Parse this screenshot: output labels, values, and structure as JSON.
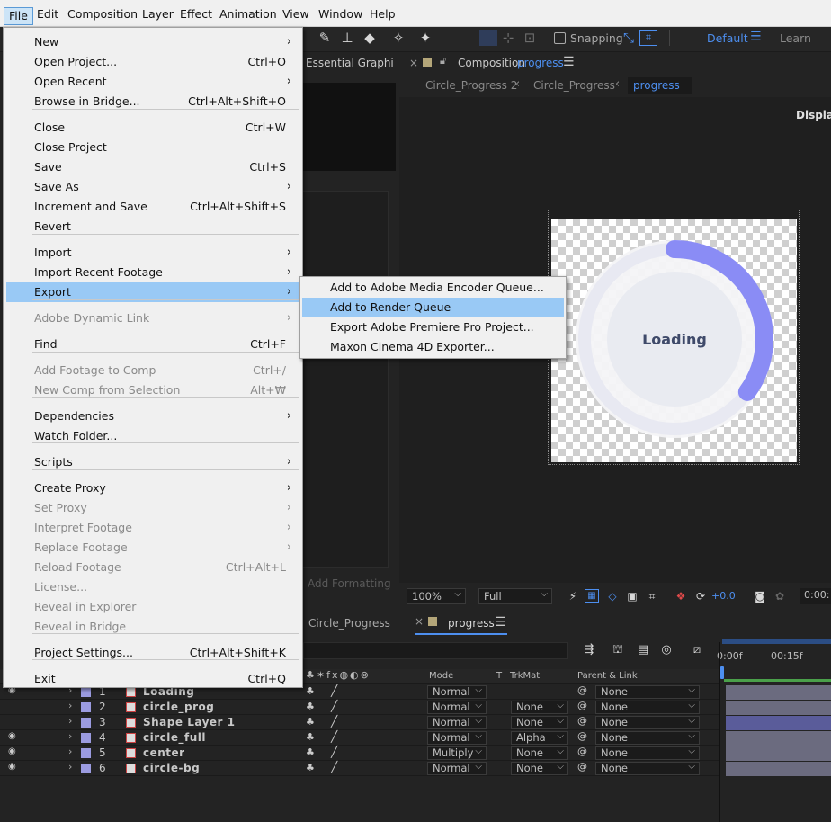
{
  "menubar": {
    "items": [
      "File",
      "Edit",
      "Composition",
      "Layer",
      "Effect",
      "Animation",
      "View",
      "Window",
      "Help"
    ]
  },
  "toolbar": {
    "snapping_label": "Snapping",
    "workspace_default": "Default",
    "workspace_learn": "Learn"
  },
  "file_menu": {
    "items": [
      {
        "label": "New",
        "shortcut": "",
        "arrow": "›"
      },
      {
        "label": "Open Project...",
        "shortcut": "Ctrl+O",
        "arrow": ""
      },
      {
        "label": "Open Recent",
        "shortcut": "",
        "arrow": "›"
      },
      {
        "label": "Browse in Bridge...",
        "shortcut": "Ctrl+Alt+Shift+O",
        "arrow": ""
      },
      {
        "label": "Close",
        "shortcut": "Ctrl+W",
        "arrow": ""
      },
      {
        "label": "Close Project",
        "shortcut": "",
        "arrow": ""
      },
      {
        "label": "Save",
        "shortcut": "Ctrl+S",
        "arrow": ""
      },
      {
        "label": "Save As",
        "shortcut": "",
        "arrow": "›"
      },
      {
        "label": "Increment and Save",
        "shortcut": "Ctrl+Alt+Shift+S",
        "arrow": ""
      },
      {
        "label": "Revert",
        "shortcut": "",
        "arrow": ""
      },
      {
        "label": "Import",
        "shortcut": "",
        "arrow": "›"
      },
      {
        "label": "Import Recent Footage",
        "shortcut": "",
        "arrow": "›"
      },
      {
        "label": "Export",
        "shortcut": "",
        "arrow": "›"
      },
      {
        "label": "Adobe Dynamic Link",
        "shortcut": "",
        "arrow": "›"
      },
      {
        "label": "Find",
        "shortcut": "Ctrl+F",
        "arrow": ""
      },
      {
        "label": "Add Footage to Comp",
        "shortcut": "Ctrl+/",
        "arrow": ""
      },
      {
        "label": "New Comp from Selection",
        "shortcut": "Alt+₩",
        "arrow": ""
      },
      {
        "label": "Dependencies",
        "shortcut": "",
        "arrow": "›"
      },
      {
        "label": "Watch Folder...",
        "shortcut": "",
        "arrow": ""
      },
      {
        "label": "Scripts",
        "shortcut": "",
        "arrow": "›"
      },
      {
        "label": "Create Proxy",
        "shortcut": "",
        "arrow": "›"
      },
      {
        "label": "Set Proxy",
        "shortcut": "",
        "arrow": "›"
      },
      {
        "label": "Interpret Footage",
        "shortcut": "",
        "arrow": "›"
      },
      {
        "label": "Replace Footage",
        "shortcut": "",
        "arrow": "›"
      },
      {
        "label": "Reload Footage",
        "shortcut": "Ctrl+Alt+L",
        "arrow": ""
      },
      {
        "label": "License...",
        "shortcut": "",
        "arrow": ""
      },
      {
        "label": "Reveal in Explorer",
        "shortcut": "",
        "arrow": ""
      },
      {
        "label": "Reveal in Bridge",
        "shortcut": "",
        "arrow": ""
      },
      {
        "label": "Project Settings...",
        "shortcut": "Ctrl+Alt+Shift+K",
        "arrow": ""
      },
      {
        "label": "Exit",
        "shortcut": "Ctrl+Q",
        "arrow": ""
      }
    ]
  },
  "export_submenu": {
    "items": [
      "Add to Adobe Media Encoder Queue...",
      "Add to Render Queue",
      "Export Adobe Premiere Pro Project...",
      "Maxon Cinema 4D Exporter..."
    ]
  },
  "left_panel": {
    "tab_label": "Essential Graphi",
    "add_formatting": "Add Formatting"
  },
  "composition": {
    "tab_prefix": "Composition",
    "tab_name": "progress",
    "breadcrumbs": [
      "Circle_Progress 2",
      "Circle_Progress",
      "progress"
    ],
    "display_label": "Display",
    "canvas_text": "Loading",
    "progress_fraction": 0.35,
    "zoom": "100%",
    "resolution": "Full",
    "exposure": "+0.0",
    "timecode": "0:00:"
  },
  "timeline": {
    "tabs": [
      "Circle_Progress",
      "progress"
    ],
    "ruler": [
      "0:00f",
      "00:15f"
    ],
    "col_mode": "Mode",
    "col_t": "T",
    "col_trkmat": "TrkMat",
    "col_parent": "Parent & Link",
    "layers": [
      {
        "num": "1",
        "name": "Loading",
        "mode": "Normal",
        "trkmat": "",
        "parent": "None",
        "visible": true
      },
      {
        "num": "2",
        "name": "circle_prog",
        "mode": "Normal",
        "trkmat": "None",
        "parent": "None",
        "visible": false
      },
      {
        "num": "3",
        "name": "Shape Layer 1",
        "mode": "Normal",
        "trkmat": "None",
        "parent": "None",
        "visible": false
      },
      {
        "num": "4",
        "name": "circle_full",
        "mode": "Normal",
        "trkmat": "Alpha",
        "parent": "None",
        "visible": true
      },
      {
        "num": "5",
        "name": "center",
        "mode": "Multiply",
        "trkmat": "None",
        "parent": "None",
        "visible": true
      },
      {
        "num": "6",
        "name": "circle-bg",
        "mode": "Normal",
        "trkmat": "None",
        "parent": "None",
        "visible": true
      }
    ]
  },
  "colors": {
    "accent_blue": "#4d8ff0",
    "progress_ring": "#8a8cf5",
    "menu_highlight": "#99c9f5"
  }
}
